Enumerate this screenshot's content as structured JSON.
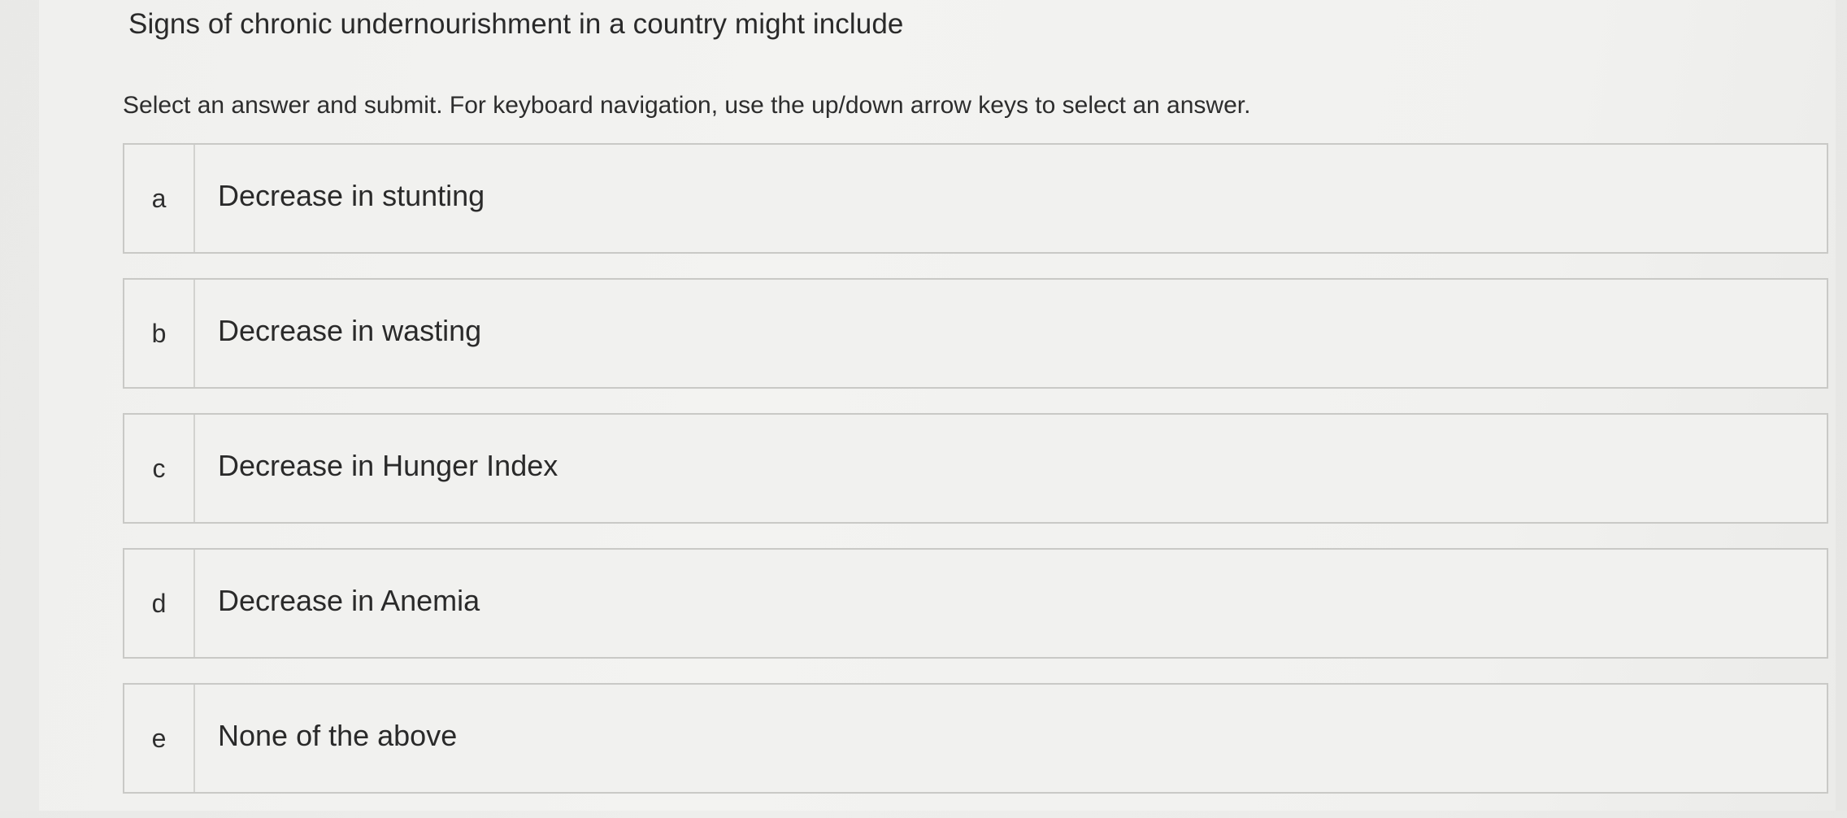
{
  "question": {
    "title": "Signs of chronic undernourishment in a country might include"
  },
  "instructions": "Select an answer and submit. For keyboard navigation, use the up/down arrow keys to select an answer.",
  "options": [
    {
      "letter": "a",
      "text": "Decrease in stunting"
    },
    {
      "letter": "b",
      "text": "Decrease in wasting"
    },
    {
      "letter": "c",
      "text": "Decrease in Hunger Index"
    },
    {
      "letter": "d",
      "text": "Decrease in Anemia"
    },
    {
      "letter": "e",
      "text": "None of the above"
    }
  ],
  "colors": {
    "background": "#efefed",
    "border": "#c9c9c6",
    "text": "#2a2a2a"
  }
}
